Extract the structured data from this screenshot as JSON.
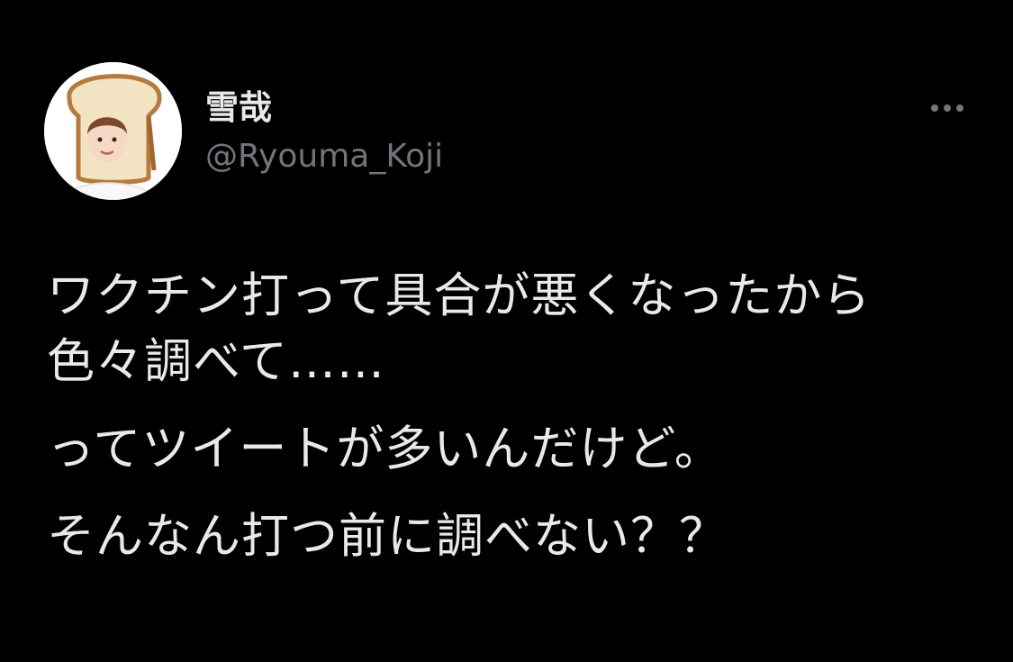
{
  "user": {
    "display_name": "雪哉",
    "handle": "@Ryouma_Koji"
  },
  "tweet": {
    "paragraphs": [
      "ワクチン打って具合が悪くなったから色々調べて……",
      "ってツイートが多いんだけど。",
      "そんなん打つ前に調べない？？"
    ]
  },
  "icons": {
    "more": "more-horizontal-icon"
  },
  "colors": {
    "background": "#000000",
    "primary_text": "#e7e9ea",
    "secondary_text": "#71767b"
  }
}
